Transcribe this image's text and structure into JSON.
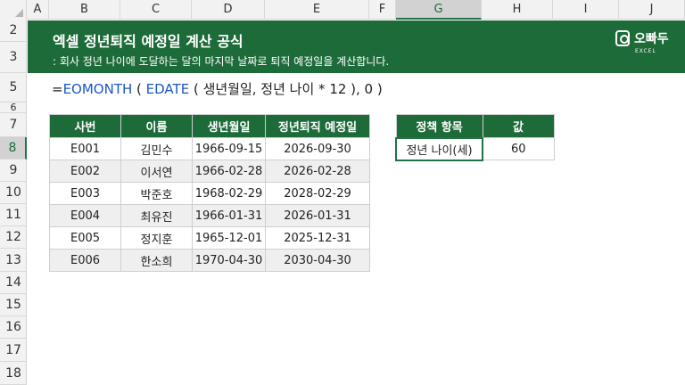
{
  "columns": [
    "A",
    "B",
    "C",
    "D",
    "E",
    "F",
    "G",
    "H",
    "I",
    "J"
  ],
  "selected_column": "G",
  "rows": [
    "2",
    "3",
    "5",
    "6",
    "7",
    "8",
    "9",
    "10",
    "11",
    "12",
    "13",
    "14",
    "15",
    "16",
    "17",
    "18"
  ],
  "selected_row": "8",
  "banner": {
    "title": "엑셀 정년퇴직 예정일 계산 공식",
    "subtitle": ": 회사 정년 나이에 도달하는 달의 마지막 날짜로 퇴직 예정일을 계산합니다.",
    "logo_name": "오빠두",
    "logo_sub": "EXCEL"
  },
  "formula": {
    "prefix": "=",
    "fn1": "EOMONTH",
    "part1": " ( ",
    "fn2": "EDATE",
    "part2": " ( 생년월일, 정년 나이 * 12 ), 0 )"
  },
  "employee_table": {
    "headers": [
      "사번",
      "이름",
      "생년월일",
      "정년퇴직 예정일"
    ],
    "rows": [
      [
        "E001",
        "김민수",
        "1966-09-15",
        "2026-09-30"
      ],
      [
        "E002",
        "이서연",
        "1966-02-28",
        "2026-02-28"
      ],
      [
        "E003",
        "박준호",
        "1968-02-29",
        "2028-02-29"
      ],
      [
        "E004",
        "최유진",
        "1966-01-31",
        "2026-01-31"
      ],
      [
        "E005",
        "정지훈",
        "1965-12-01",
        "2025-12-31"
      ],
      [
        "E006",
        "한소희",
        "1970-04-30",
        "2030-04-30"
      ]
    ]
  },
  "policy_table": {
    "headers": [
      "정책 항목",
      "값"
    ],
    "rows": [
      [
        "정년 나이(세)",
        "60"
      ]
    ]
  },
  "colors": {
    "brand_green": "#1e6b3a",
    "function_blue": "#1a57c6",
    "selection_green": "#217346"
  }
}
